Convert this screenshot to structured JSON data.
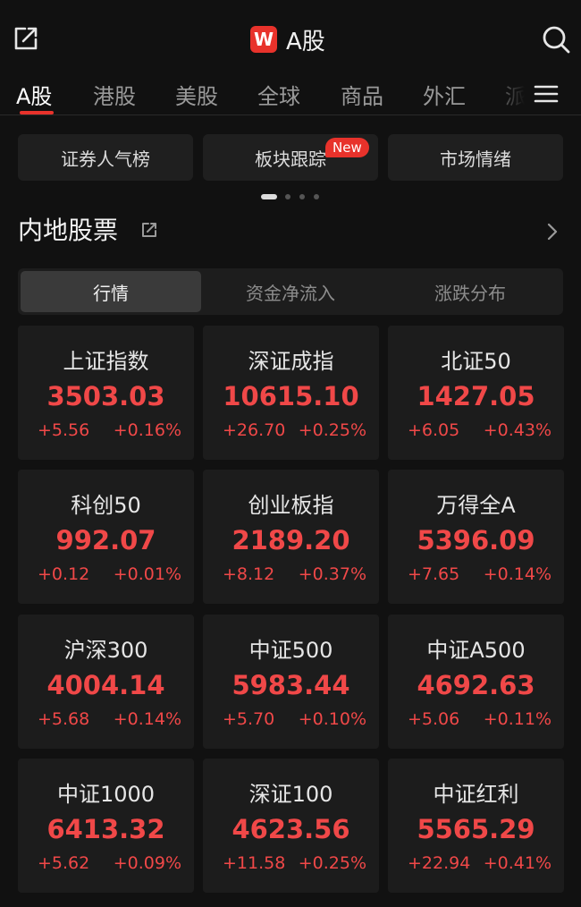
{
  "header": {
    "title": "A股",
    "logo_letter": "W",
    "brand_color": "#e8322b"
  },
  "icons": {
    "share": "share-icon",
    "search": "search-icon",
    "menu": "menu-icon",
    "arrow": "chevron-right-icon"
  },
  "tabs": [
    {
      "label": "A股",
      "active": true
    },
    {
      "label": "港股"
    },
    {
      "label": "美股"
    },
    {
      "label": "全球"
    },
    {
      "label": "商品"
    },
    {
      "label": "外汇"
    },
    {
      "label": "派"
    }
  ],
  "quick_links": [
    {
      "label": "证券人气榜"
    },
    {
      "label": "板块跟踪",
      "badge": "New"
    },
    {
      "label": "市场情绪"
    }
  ],
  "pager": {
    "count": 4,
    "active": 0
  },
  "section": {
    "title": "内地股票"
  },
  "segments": [
    {
      "label": "行情",
      "active": true
    },
    {
      "label": "资金净流入"
    },
    {
      "label": "涨跌分布"
    }
  ],
  "indices": [
    {
      "name": "上证指数",
      "price": "3503.03",
      "change": "+5.56",
      "pct": "+0.16%"
    },
    {
      "name": "深证成指",
      "price": "10615.10",
      "change": "+26.70",
      "pct": "+0.25%"
    },
    {
      "name": "北证50",
      "price": "1427.05",
      "change": "+6.05",
      "pct": "+0.43%"
    },
    {
      "name": "科创50",
      "price": "992.07",
      "change": "+0.12",
      "pct": "+0.01%"
    },
    {
      "name": "创业板指",
      "price": "2189.20",
      "change": "+8.12",
      "pct": "+0.37%"
    },
    {
      "name": "万得全A",
      "price": "5396.09",
      "change": "+7.65",
      "pct": "+0.14%"
    },
    {
      "name": "沪深300",
      "price": "4004.14",
      "change": "+5.68",
      "pct": "+0.14%"
    },
    {
      "name": "中证500",
      "price": "5983.44",
      "change": "+5.70",
      "pct": "+0.10%"
    },
    {
      "name": "中证A500",
      "price": "4692.63",
      "change": "+5.06",
      "pct": "+0.11%"
    },
    {
      "name": "中证1000",
      "price": "6413.32",
      "change": "+5.62",
      "pct": "+0.09%"
    },
    {
      "name": "深证100",
      "price": "4623.56",
      "change": "+11.58",
      "pct": "+0.25%"
    },
    {
      "name": "中证红利",
      "price": "5565.29",
      "change": "+22.94",
      "pct": "+0.41%"
    }
  ],
  "colors": {
    "up": "#f04848",
    "accent": "#e8322b",
    "background": "#111111"
  }
}
